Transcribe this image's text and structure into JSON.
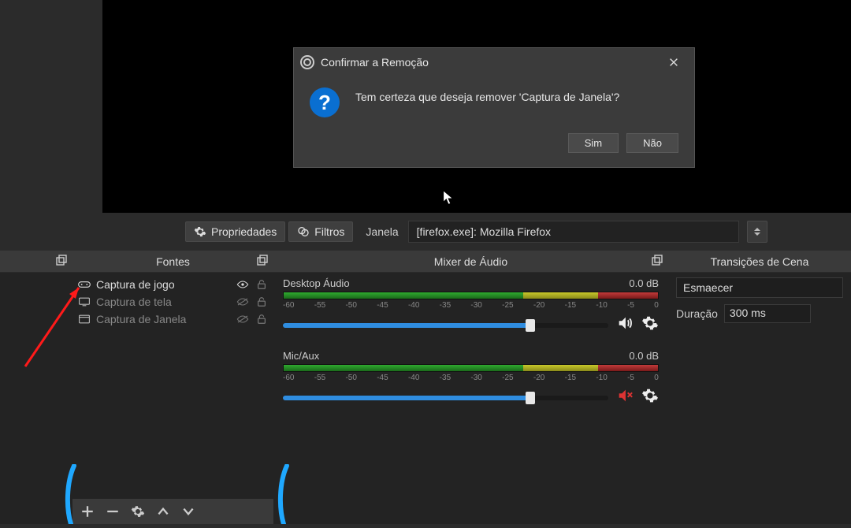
{
  "dialog": {
    "title": "Confirmar a Remoção",
    "message": "Tem certeza que deseja remover 'Captura de Janela'?",
    "yes": "Sim",
    "no": "Não"
  },
  "toolbar": {
    "properties": "Propriedades",
    "filters": "Filtros",
    "window_label": "Janela",
    "window_value": "[firefox.exe]: Mozilla Firefox"
  },
  "panels": {
    "sources_title": "Fontes",
    "mixer_title": "Mixer de Áudio",
    "transitions_title": "Transições de Cena"
  },
  "sources": [
    {
      "label": "Captura de jogo",
      "visible": true
    },
    {
      "label": "Captura de tela",
      "visible": false
    },
    {
      "label": "Captura de Janela",
      "visible": false
    }
  ],
  "mixer": {
    "ticks": [
      "-60",
      "-55",
      "-50",
      "-45",
      "-40",
      "-35",
      "-30",
      "-25",
      "-20",
      "-15",
      "-10",
      "-5",
      "0"
    ],
    "channels": [
      {
        "name": "Desktop Áudio",
        "level": "0.0 dB",
        "muted": false
      },
      {
        "name": "Mic/Aux",
        "level": "0.0 dB",
        "muted": true
      }
    ]
  },
  "transitions": {
    "selected": "Esmaecer",
    "duration_label": "Duração",
    "duration_value": "300 ms"
  }
}
